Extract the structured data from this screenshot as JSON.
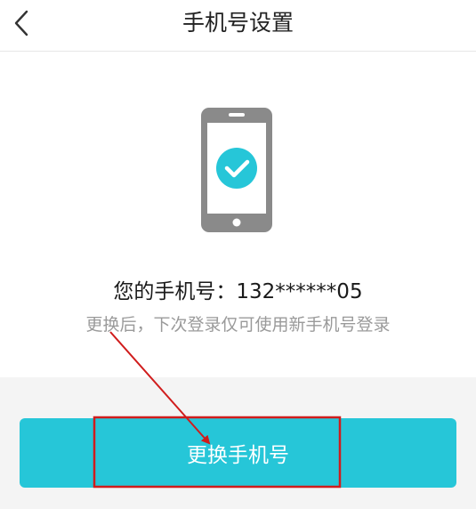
{
  "header": {
    "title": "手机号设置",
    "back_icon": "chevron-left-icon"
  },
  "main": {
    "illustration_icon": "phone-check-icon",
    "phone_label": "您的手机号：",
    "phone_number": "132******05",
    "hint": "更换后，下次登录仅可使用新手机号登录"
  },
  "actions": {
    "change_label": "更换手机号"
  },
  "colors": {
    "accent": "#26c6d8",
    "phone_body": "#8a8a8a",
    "annotation": "#d01c1c"
  }
}
